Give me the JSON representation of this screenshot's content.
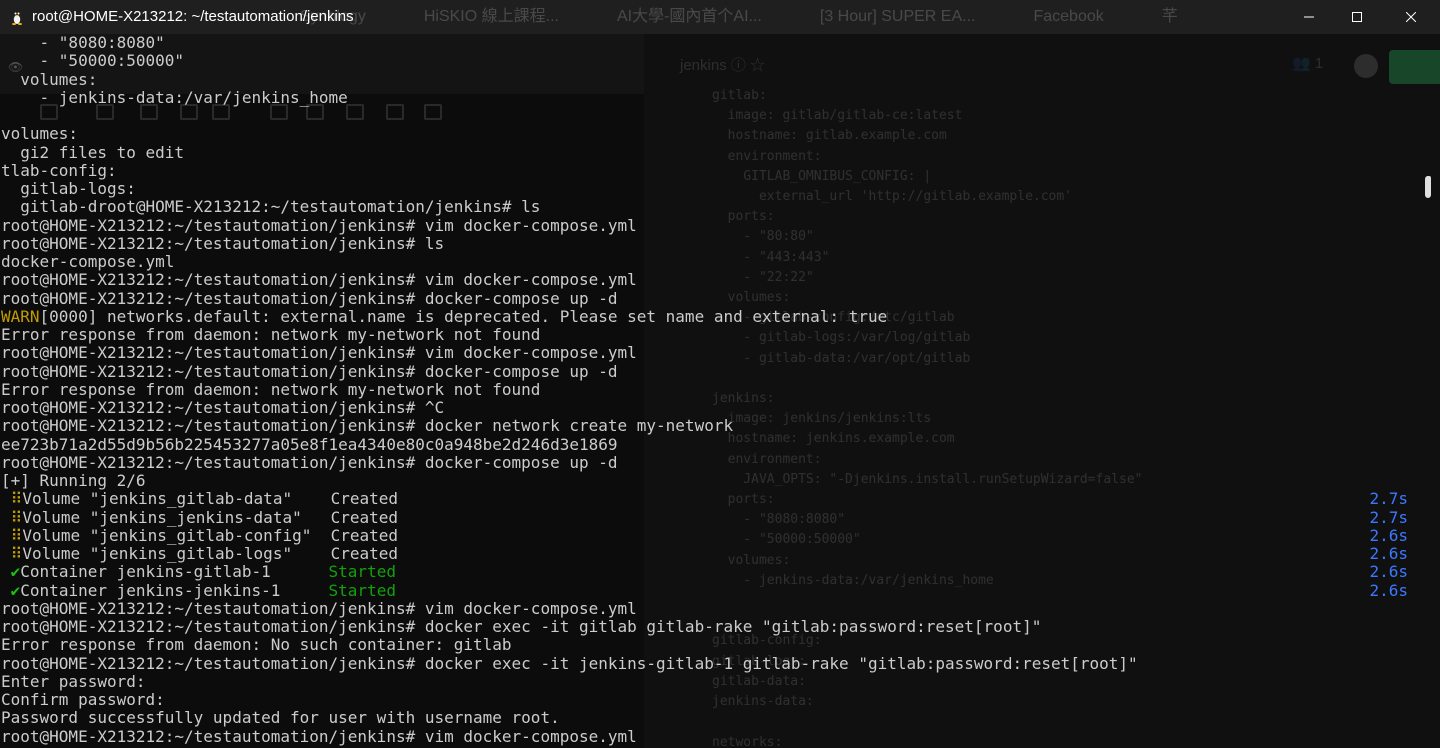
{
  "window": {
    "title": "root@HOME-X213212: ~/testautomation/jenkins",
    "background_tabs": [
      "Synology",
      "HiSKIO 線上課程...",
      "AI大學-國內首个AI...",
      "[3 Hour] SUPER EA...",
      "Facebook",
      "芊"
    ]
  },
  "colors": {
    "terminal_bg": "#0c0c0c",
    "text": "#cccccc",
    "warn": "#c19c00",
    "started": "#13a10e",
    "duration": "#3b78ff"
  },
  "background_editor": {
    "file_name": "jenkins",
    "people_count": "1",
    "lines": [
      "gitlab:",
      "  image: gitlab/gitlab-ce:latest",
      "  hostname: gitlab.example.com",
      "  environment:",
      "    GITLAB_OMNIBUS_CONFIG: |",
      "      external_url 'http://gitlab.example.com'",
      "  ports:",
      "    - \"80:80\"",
      "    - \"443:443\"",
      "    - \"22:22\"",
      "  volumes:",
      "    - gitlab-config:/etc/gitlab",
      "    - gitlab-logs:/var/log/gitlab",
      "    - gitlab-data:/var/opt/gitlab",
      "",
      "jenkins:",
      "  image: jenkins/jenkins:lts",
      "  hostname: jenkins.example.com",
      "  environment:",
      "    JAVA_OPTS: \"-Djenkins.install.runSetupWizard=false\"",
      "  ports:",
      "    - \"8080:8080\"",
      "    - \"50000:50000\"",
      "  volumes:",
      "    - jenkins-data:/var/jenkins_home",
      "",
      "",
      "gitlab-config:",
      "gitlab-logs:",
      "gitlab-data:",
      "jenkins-data:",
      "",
      "networks:"
    ]
  },
  "terminal": {
    "lines": [
      {
        "text": "    - \"8080:8080\""
      },
      {
        "text": "    - \"50000:50000\""
      },
      {
        "text": "  volumes:"
      },
      {
        "text": "    - jenkins-data:/var/jenkins_home"
      },
      {
        "text": ""
      },
      {
        "text": "volumes:"
      },
      {
        "text": "  gi2 files to edit"
      },
      {
        "text": "tlab-config:"
      },
      {
        "text": "  gitlab-logs:"
      },
      {
        "text": "  gitlab-droot@HOME-X213212:~/testautomation/jenkins# ls"
      },
      {
        "text": "root@HOME-X213212:~/testautomation/jenkins# vim docker-compose.yml"
      },
      {
        "text": "root@HOME-X213212:~/testautomation/jenkins# ls"
      },
      {
        "text": "docker-compose.yml"
      },
      {
        "text": "root@HOME-X213212:~/testautomation/jenkins# vim docker-compose.yml"
      },
      {
        "text": "root@HOME-X213212:~/testautomation/jenkins# docker-compose up -d"
      },
      {
        "warn": "WARN",
        "text": "[0000] networks.default: external.name is deprecated. Please set name and external: true"
      },
      {
        "text": "Error response from daemon: network my-network not found"
      },
      {
        "text": "root@HOME-X213212:~/testautomation/jenkins# vim docker-compose.yml"
      },
      {
        "text": "root@HOME-X213212:~/testautomation/jenkins# docker-compose up -d"
      },
      {
        "text": "Error response from daemon: network my-network not found"
      },
      {
        "text": "root@HOME-X213212:~/testautomation/jenkins# ^C"
      },
      {
        "text": "root@HOME-X213212:~/testautomation/jenkins# docker network create my-network"
      },
      {
        "text": "ee723b71a2d55d9b56b225453277a05e8f1ea4340e80c0a948be2d246d3e1869"
      },
      {
        "text": "root@HOME-X213212:~/testautomation/jenkins# docker-compose up -d"
      },
      {
        "text": "[+] Running 2/6"
      },
      {
        "icon": "⠿",
        "text": "Volume \"jenkins_gitlab-data\"    ",
        "status": "Created",
        "duration": "2.7s"
      },
      {
        "icon": "⠿",
        "text": "Volume \"jenkins_jenkins-data\"   ",
        "status": "Created",
        "duration": "2.7s"
      },
      {
        "icon": "⠿",
        "text": "Volume \"jenkins_gitlab-config\"  ",
        "status": "Created",
        "duration": "2.6s"
      },
      {
        "icon": "⠿",
        "text": "Volume \"jenkins_gitlab-logs\"    ",
        "status": "Created",
        "duration": "2.6s"
      },
      {
        "icon": "✔",
        "text": "Container jenkins-gitlab-1      ",
        "status": "Started",
        "duration": "2.6s"
      },
      {
        "icon": "✔",
        "text": "Container jenkins-jenkins-1     ",
        "status": "Started",
        "duration": "2.6s"
      },
      {
        "text": "root@HOME-X213212:~/testautomation/jenkins# vim docker-compose.yml"
      },
      {
        "text": "root@HOME-X213212:~/testautomation/jenkins# docker exec -it gitlab gitlab-rake \"gitlab:password:reset[root]\""
      },
      {
        "text": "Error response from daemon: No such container: gitlab"
      },
      {
        "text": "root@HOME-X213212:~/testautomation/jenkins# docker exec -it jenkins-gitlab-1 gitlab-rake \"gitlab:password:reset[root]\""
      },
      {
        "text": "Enter password:"
      },
      {
        "text": "Confirm password:"
      },
      {
        "text": "Password successfully updated for user with username root."
      },
      {
        "text": "root@HOME-X213212:~/testautomation/jenkins# vim docker-compose.yml"
      }
    ]
  }
}
